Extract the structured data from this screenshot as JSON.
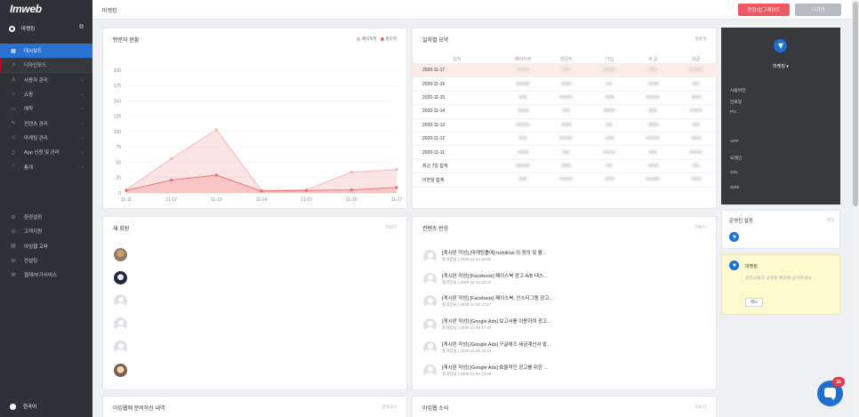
{
  "sidebar": {
    "logo": "Imweb",
    "site_name": "마켓킹",
    "menu": [
      {
        "label": "대시보드",
        "icon": "grid-icon",
        "arrow": false
      },
      {
        "label": "디자인모드",
        "icon": "pencil-icon",
        "arrow": false
      },
      {
        "label": "사용자 관리",
        "icon": "user-icon",
        "arrow": true
      },
      {
        "label": "쇼핑",
        "icon": "shopping-bag-icon",
        "arrow": true
      },
      {
        "label": "예약",
        "icon": "calendar-icon",
        "arrow": true
      },
      {
        "label": "컨텐츠 관리",
        "icon": "edit-icon",
        "arrow": true
      },
      {
        "label": "마케팅 관리",
        "icon": "megaphone-icon",
        "arrow": true
      },
      {
        "label": "App 신청 및 관리",
        "icon": "phone-icon",
        "arrow": true
      },
      {
        "label": "통계",
        "icon": "trend-icon",
        "arrow": true
      }
    ],
    "menu2": [
      {
        "label": "환경설정",
        "icon": "gear-icon"
      },
      {
        "label": "고객지원",
        "icon": "support-icon"
      },
      {
        "label": "아임웹 교육",
        "icon": "book-icon"
      },
      {
        "label": "컨설팅",
        "icon": "mail-icon"
      },
      {
        "label": "결제/부가서비스",
        "icon": "wrench-icon"
      }
    ],
    "language": "한국어"
  },
  "topbar": {
    "title": "마켓킹",
    "upgrade_label": "연장/업그레이드",
    "exit_label": "나가기"
  },
  "visitors": {
    "title": "방문자 현황",
    "legend_pageviews": "페이지뷰",
    "legend_visitors": "방문자"
  },
  "chart_data": {
    "type": "area",
    "x": [
      "11-11",
      "11-12",
      "11-13",
      "11-14",
      "11-15",
      "11-16",
      "11-17"
    ],
    "ylim": [
      0,
      200
    ],
    "yticks": [
      0,
      25,
      50,
      75,
      100,
      125,
      150,
      175,
      200
    ],
    "series": [
      {
        "name": "페이지뷰",
        "color": "#f4b2b2",
        "values": [
          5,
          56,
          103,
          4,
          5,
          34,
          38
        ]
      },
      {
        "name": "방문자",
        "color": "#ef6a6a",
        "values": [
          4,
          21,
          29,
          3,
          4,
          5,
          9
        ]
      }
    ],
    "grid": true,
    "legend": "top-right"
  },
  "daily": {
    "title": "일자별 요약",
    "more": "월통계",
    "headers": [
      "일자",
      "페이지뷰",
      "방문자",
      "가입",
      "새 글",
      "댓글"
    ],
    "rows": [
      "2020-11-17",
      "2020-11-16",
      "2020-11-15",
      "2020-11-14",
      "2020-11-13",
      "2020-11-12",
      "2020-11-11",
      "최근 7일 합계",
      "이번달 합계"
    ]
  },
  "members": {
    "title": "새 회원",
    "more": "더보기"
  },
  "reactions": {
    "title": "컨텐츠 반응",
    "more": "더보기",
    "items": [
      {
        "title": "[게시판 작성] [마케팅툴에] nofollow 의 정의 및 활...",
        "meta": "홍과장님 | 2020-11-12 10:52"
      },
      {
        "title": "[게시판 작성] [Facebook] 페이스북 광고 A/B 테스...",
        "meta": "홍과장님 | 2020-11-12 10:47"
      },
      {
        "title": "[게시판 작성] [Facebook] 페이스북, 인스타그램 광고...",
        "meta": "홍과장님 | 2020-11-10 17:17"
      },
      {
        "title": "[게시판 작성] [Google Ads] 보고서를 이용하여 광고...",
        "meta": "홍과장님 | 2020-11-09 17:44"
      },
      {
        "title": "[게시판 작성] [Google Ads] 구글애즈 세금계산서 발...",
        "meta": "홍과장님 | 2020-11-06 10:14"
      },
      {
        "title": "[게시판 작성] [Google Ads] 효율적인 광고를 위한 ...",
        "meta": "홍과장님 | 2020-11-03 14:28"
      }
    ]
  },
  "inquiry": {
    "title": "아임웹에 문의하신 내역",
    "more": "문의하기"
  },
  "news": {
    "title": "아임웹 소식",
    "more": "더보기"
  },
  "right": {
    "site_name": "마켓킹 ▾",
    "group1": [
      "사용버전",
      "만료일",
      "PG"
    ],
    "group2": [
      "APP",
      "도메인",
      "SSL",
      "SMS"
    ]
  },
  "operator": {
    "title": "운영진 설정",
    "more": "관리"
  },
  "memo": {
    "name": "마켓킹",
    "placeholder": "관리자들과 공유할 메모를 남겨주세요",
    "button": "메모"
  },
  "chat": {
    "badge": "26"
  }
}
